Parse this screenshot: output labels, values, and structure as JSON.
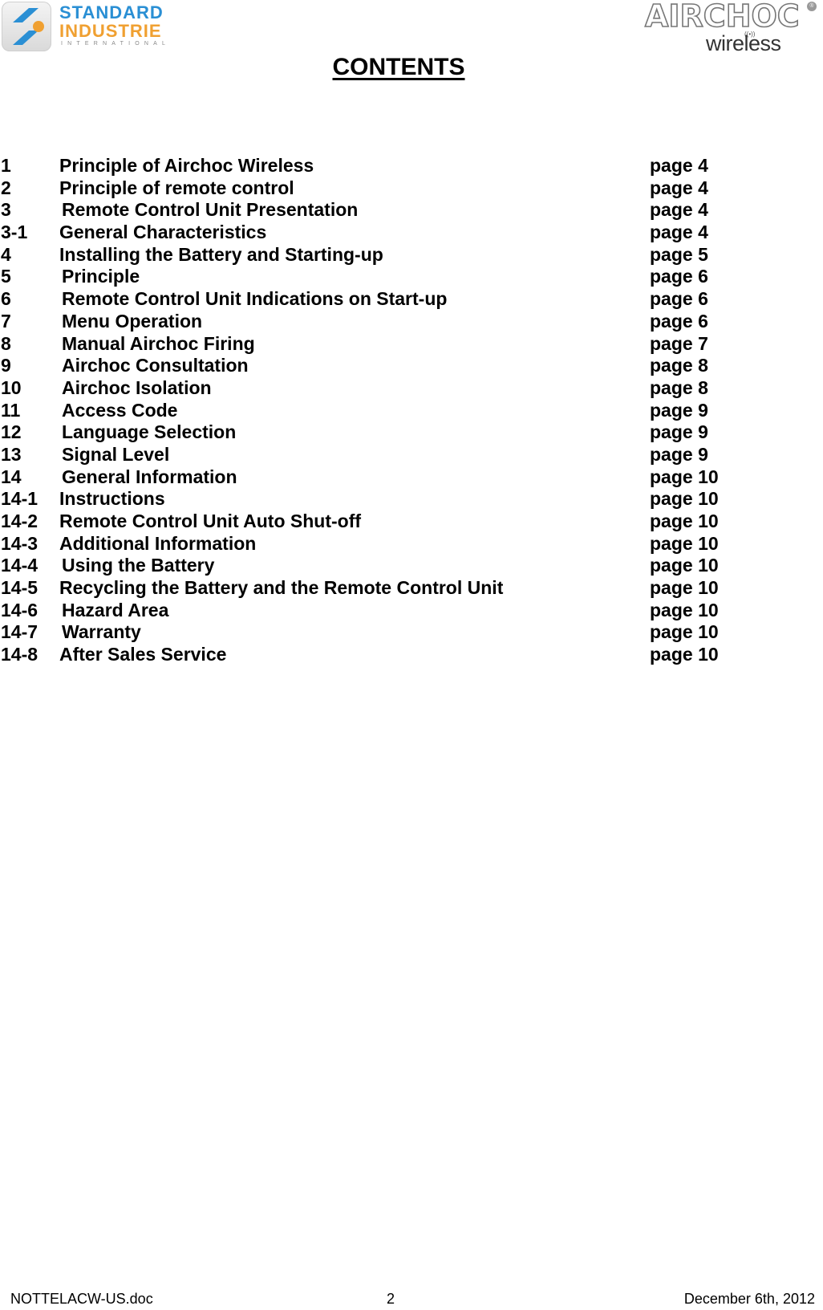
{
  "header": {
    "left_logo": {
      "name": "standard-industrie-logo",
      "line1": "STANDARD",
      "line2": "INDUSTRIE",
      "line3": "INTERNATIONAL",
      "colors": {
        "blue": "#2a8fd4",
        "orange": "#f0a031"
      }
    },
    "right_logo": {
      "name": "airchoc-wireless-logo",
      "brand": "AIRCHOC",
      "registered": "®",
      "signal": "((•))",
      "sub": "wireless"
    }
  },
  "title": "CONTENTS",
  "toc": [
    {
      "num": "1",
      "label": "Principle of Airchoc Wireless",
      "page": "page 4"
    },
    {
      "num": "2",
      "label": "Principle of remote control",
      "page": "page 4"
    },
    {
      "num": "3",
      "label": "Remote Control Unit Presentation",
      "page": "page 4"
    },
    {
      "num": "3-1",
      "label": "General Characteristics",
      "page": "page 4"
    },
    {
      "num": "4",
      "label": "Installing the Battery and Starting-up",
      "page": "page 5"
    },
    {
      "num": "5",
      "label": "Principle",
      "page": "page 6"
    },
    {
      "num": "6",
      "label": "Remote Control Unit Indications on Start-up",
      "page": "page 6"
    },
    {
      "num": "7",
      "label": "Menu Operation",
      "page": "page 6"
    },
    {
      "num": "8",
      "label": "Manual Airchoc Firing",
      "page": "page 7"
    },
    {
      "num": "9",
      "label": "Airchoc Consultation",
      "page": "page 8"
    },
    {
      "num": "10",
      "label": "Airchoc Isolation",
      "page": "page 8"
    },
    {
      "num": "11",
      "label": "Access Code",
      "page": "page 9"
    },
    {
      "num": "12",
      "label": "Language Selection",
      "page": "page 9"
    },
    {
      "num": "13",
      "label": "Signal Level",
      "page": "page 9"
    },
    {
      "num": "14",
      "label": "General Information",
      "page": "page 10"
    },
    {
      "num": "14-1",
      "label": "Instructions",
      "page": "page 10"
    },
    {
      "num": "14-2",
      "label": "Remote Control Unit Auto Shut-off",
      "page": "page 10"
    },
    {
      "num": "14-3",
      "label": "Additional Information",
      "page": "page 10"
    },
    {
      "num": "14-4",
      "label": "Using the Battery",
      "page": "page 10"
    },
    {
      "num": "14-5",
      "label": "Recycling the Battery and the Remote Control Unit",
      "page": "page 10"
    },
    {
      "num": "14-6",
      "label": "Hazard Area",
      "page": "page 10"
    },
    {
      "num": "14-7",
      "label": "Warranty",
      "page": "page 10"
    },
    {
      "num": "14-8",
      "label": "After Sales Service",
      "page": "page 10"
    }
  ],
  "footer": {
    "filename": "NOTTELACW-US.doc",
    "page_number": "2",
    "date": "December 6th, 2012"
  }
}
